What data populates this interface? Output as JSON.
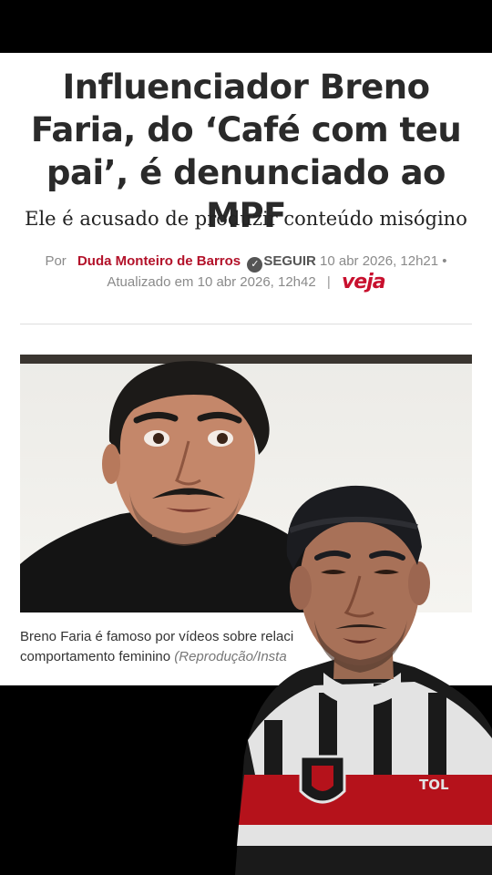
{
  "article": {
    "headline": "Influenciador Breno Faria, do ‘Café com teu pai’, é denunciado ao MPF",
    "subtitle": "Ele é acusado de produzir conteúdo misógino",
    "byline": {
      "prefix": "Por",
      "author": "Duda Monteiro de Barros",
      "follow": "SEGUIR",
      "published": "10 abr 2026, 12h21",
      "bullet": "•",
      "updated": "Atualizado em 10 abr 2026, 12h42",
      "separator": "|",
      "publication_logo": "veja"
    },
    "caption": "Breno Faria é famoso por vídeos sobre relaci",
    "caption_line2": "comportamento feminino",
    "caption_credit": "(Reprodução/Insta"
  },
  "icons": {
    "verified": "check-badge-icon"
  },
  "colors": {
    "author": "#b3122a",
    "logo": "#c8102e",
    "background_frame": "#000000"
  }
}
